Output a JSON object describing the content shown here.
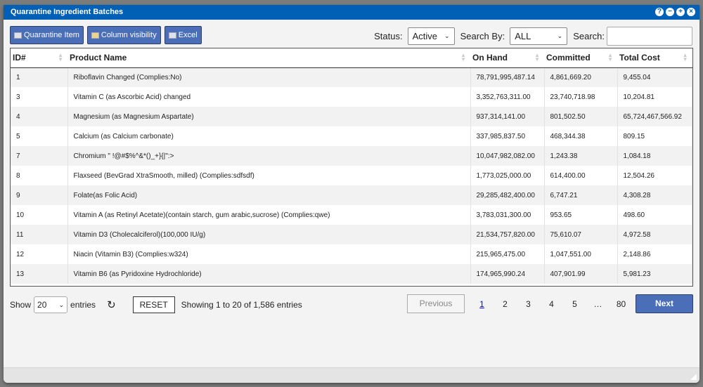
{
  "window": {
    "title": "Quarantine Ingredient Batches",
    "controls": [
      "help-icon",
      "minimize-icon",
      "maximize-icon",
      "close-icon"
    ]
  },
  "toolbar": {
    "quarantine_item": "Quarantine Item",
    "column_visibility": "Column visibility",
    "excel": "Excel"
  },
  "filters": {
    "status_label": "Status:",
    "status_value": "Active",
    "search_by_label": "Search By:",
    "search_by_value": "ALL",
    "search_label": "Search:",
    "search_value": ""
  },
  "table": {
    "columns": [
      "ID#",
      "Product Name",
      "On Hand",
      "Committed",
      "Total Cost"
    ],
    "rows": [
      [
        "1",
        "Riboflavin Changed (Complies:No)",
        "78,791,995,487.14",
        "4,861,669.20",
        "9,455.04"
      ],
      [
        "3",
        "Vitamin C (as Ascorbic Acid) changed",
        "3,352,763,311.00",
        "23,740,718.98",
        "10,204.81"
      ],
      [
        "4",
        "Magnesium (as Magnesium Aspartate)",
        "937,314,141.00",
        "801,502.50",
        "65,724,467,566.92"
      ],
      [
        "5",
        "Calcium (as Calcium carbonate)",
        "337,985,837.50",
        "468,344.38",
        "809.15"
      ],
      [
        "7",
        "Chromium \" !@#$%^&*()_+}{|\":>",
        "10,047,982,082.00",
        "1,243.38",
        "1,084.18"
      ],
      [
        "8",
        "Flaxseed (BevGrad XtraSmooth, milled) (Complies:sdfsdf)",
        "1,773,025,000.00",
        "614,400.00",
        "12,504.26"
      ],
      [
        "9",
        "Folate(as Folic Acid)",
        "29,285,482,400.00",
        "6,747.21",
        "4,308.28"
      ],
      [
        "10",
        "Vitamin A (as Retinyl Acetate)(contain starch, gum arabic,sucrose) (Complies:qwe)",
        "3,783,031,300.00",
        "953.65",
        "498.60"
      ],
      [
        "11",
        "Vitamin D3 (Cholecalciferol)(100,000 IU/g)",
        "21,534,757,820.00",
        "75,610.07",
        "4,972.58"
      ],
      [
        "12",
        "Niacin (Vitamin B3) (Complies:w324)",
        "215,965,475.00",
        "1,047,551.00",
        "2,148.86"
      ],
      [
        "13",
        "Vitamin B6 (as Pyridoxine Hydrochloride)",
        "174,965,990.24",
        "407,901.99",
        "5,981.23"
      ]
    ]
  },
  "footer": {
    "show": "Show",
    "page_size": "20",
    "entries": "entries",
    "reset": "RESET",
    "info": "Showing 1 to 20 of 1,586 entries",
    "previous": "Previous",
    "pages": [
      "1",
      "2",
      "3",
      "4",
      "5",
      "…",
      "80"
    ],
    "current_page": "1",
    "next": "Next"
  },
  "colors": {
    "titlebar": "#0060b6",
    "button": "#4a6fb8"
  }
}
